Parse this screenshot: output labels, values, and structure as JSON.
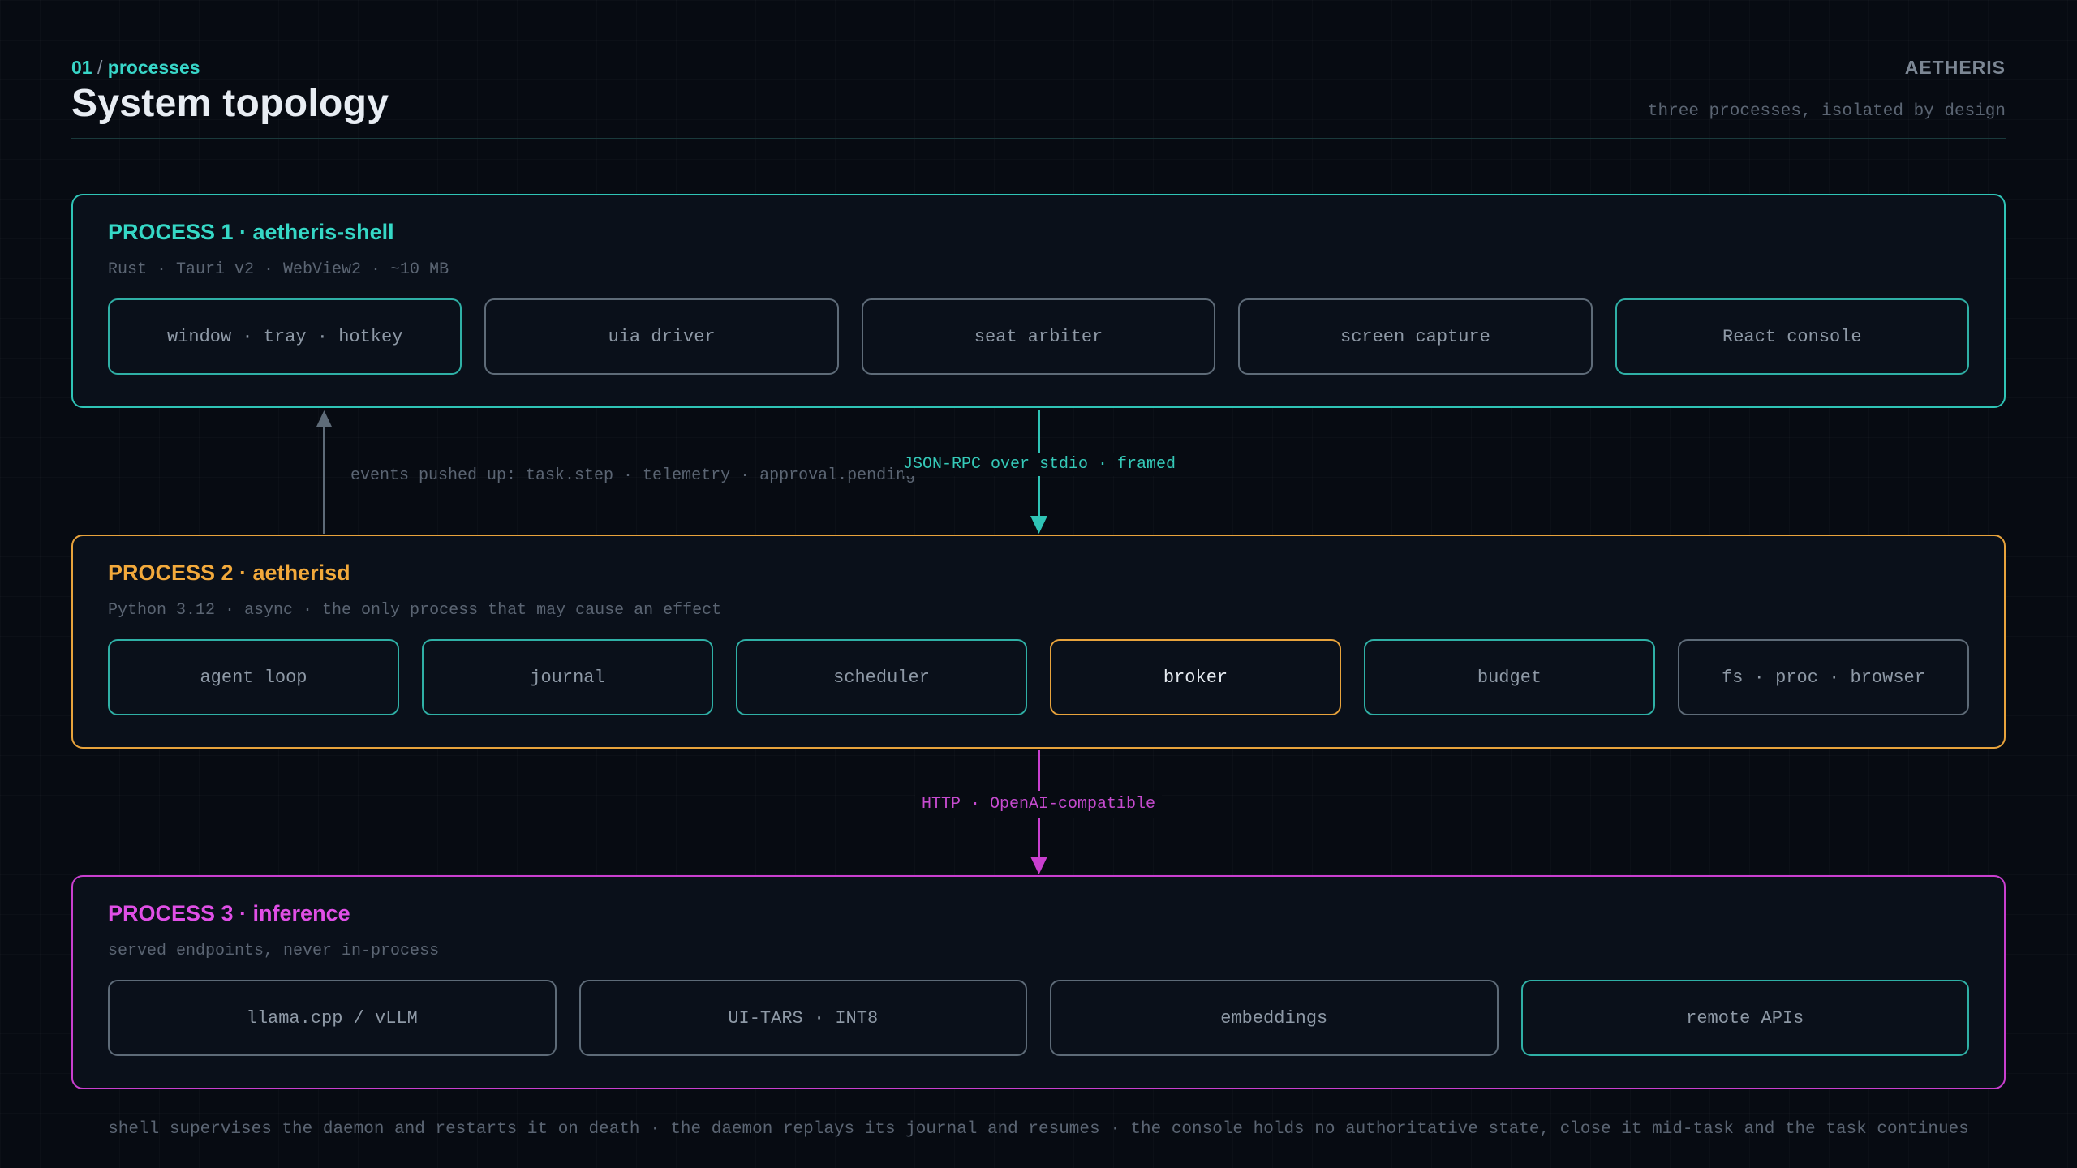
{
  "header": {
    "kicker_num": "01",
    "kicker_sep": "/",
    "kicker_label": "processes",
    "title": "System topology",
    "brand": "AETHERIS",
    "tagline": "three processes, isolated by design"
  },
  "processes": [
    {
      "title": "PROCESS 1 · aetheris-shell",
      "subtitle": "Rust · Tauri v2 · WebView2 · ~10 MB",
      "color": "#35d8c6",
      "components": [
        "window · tray · hotkey",
        "uia driver",
        "seat arbiter",
        "screen capture",
        "React console"
      ]
    },
    {
      "title": "PROCESS 2 · aetherisd",
      "subtitle": "Python 3.12 · async · the only process that may cause an effect",
      "color": "#f2a93b",
      "components": [
        "agent loop",
        "journal",
        "scheduler",
        "broker",
        "budget",
        "fs · proc · browser"
      ]
    },
    {
      "title": "PROCESS 3 · inference",
      "subtitle": "served endpoints, never in-process",
      "color": "#e04fe6",
      "components": [
        "llama.cpp / vLLM",
        "UI-TARS · INT8",
        "embeddings",
        "remote APIs"
      ]
    }
  ],
  "connections": {
    "events_up": "events pushed up: task.step · telemetry · approval.pending",
    "rpc": "JSON-RPC over stdio · framed",
    "http": "HTTP · OpenAI-compatible"
  },
  "footer": "shell supervises the daemon and restarts it on death · the daemon replays its journal and resumes · the console holds no authoritative state, close it mid-task and the task continues",
  "colors": {
    "background": "#070b12",
    "teal": "#2fc4b6",
    "amber": "#e8a33c",
    "magenta": "#c93fcf",
    "gray": "#5e6b78"
  }
}
